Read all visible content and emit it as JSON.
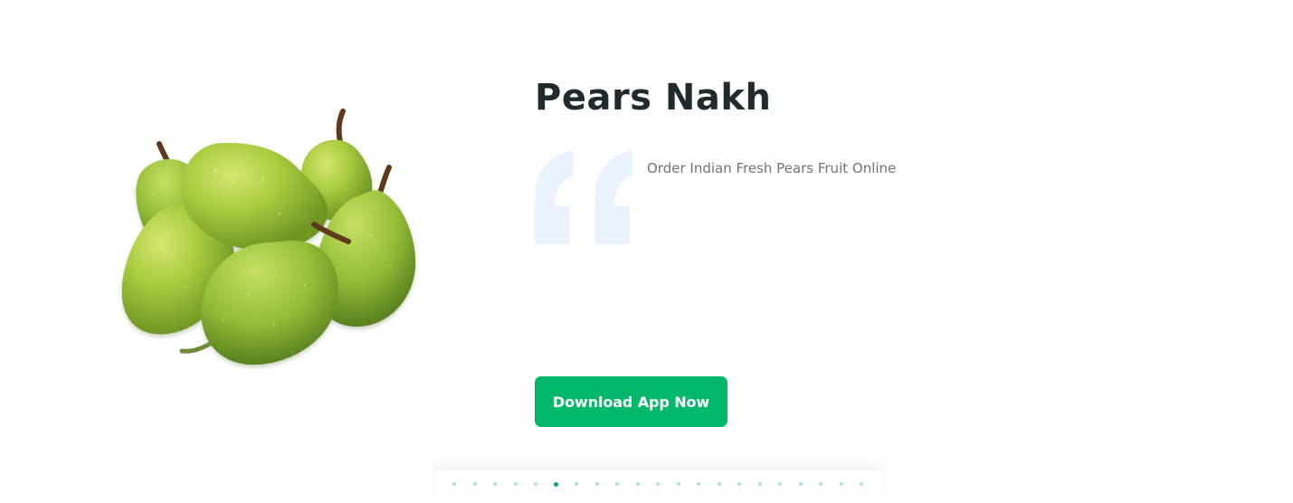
{
  "colors": {
    "primary": "#00b869",
    "title": "#1f2b2d",
    "body_text": "#6f7678",
    "quote_icon": "#eaf3fd",
    "pagination_inactive": "#a8e5c8",
    "pagination_active": "#0ca460"
  },
  "slide": {
    "image_alt": "Pears",
    "title": "Pears Nakh",
    "quote_icon": "quote-open-icon",
    "description": "Order Indian Fresh Pears Fruit Online",
    "button_label": "Download App Now"
  },
  "pagination": {
    "total": 21,
    "active_index": 5
  }
}
